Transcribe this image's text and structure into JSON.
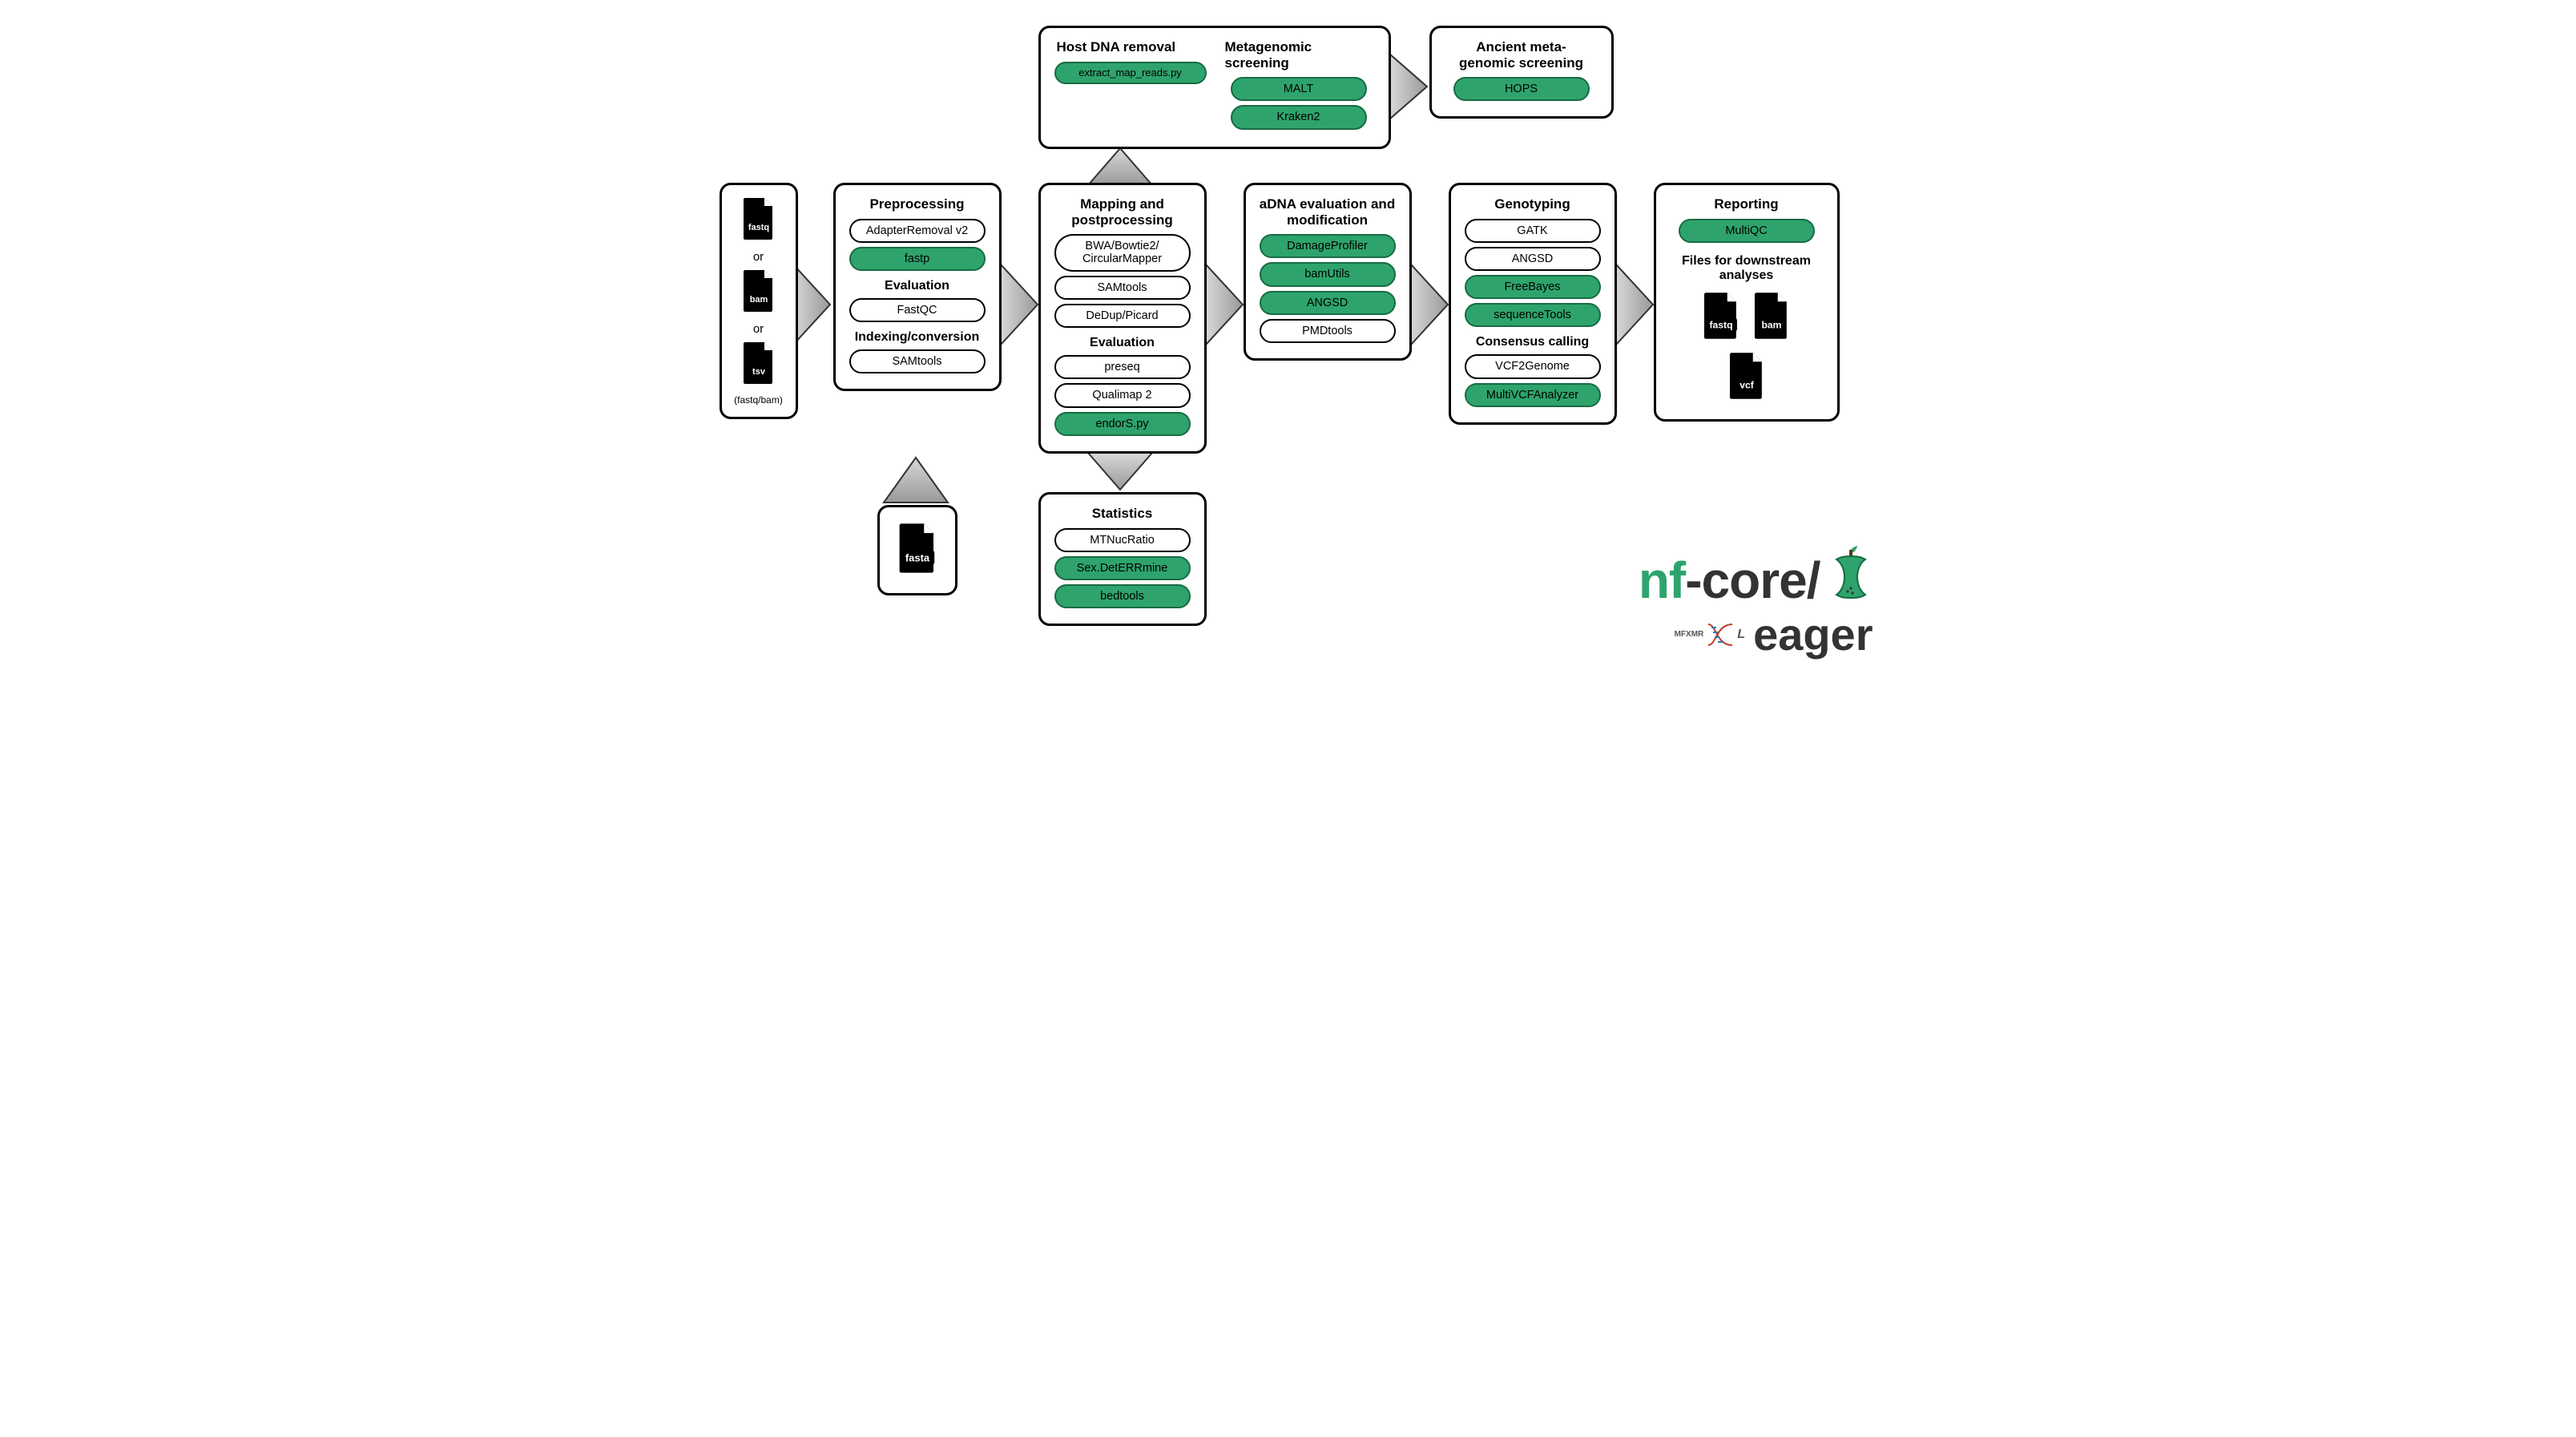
{
  "diagram_type": "pipeline-flowchart",
  "pipeline_name": "nf-core/eager",
  "input_panel": {
    "formats": [
      "fastq",
      "bam",
      "tsv"
    ],
    "or_label": "or",
    "footnote": "(fastq/bam)"
  },
  "reference_panel": {
    "format": "fasta"
  },
  "stages": {
    "preprocessing": {
      "title": "Preprocessing",
      "tools": [
        {
          "name": "AdapterRemoval v2",
          "highlighted": false
        },
        {
          "name": "fastp",
          "highlighted": true
        }
      ],
      "section2_title": "Evaluation",
      "section2_tools": [
        {
          "name": "FastQC",
          "highlighted": false
        }
      ],
      "section3_title": "Indexing/conversion",
      "section3_tools": [
        {
          "name": "SAMtools",
          "highlighted": false
        }
      ]
    },
    "mapping": {
      "title": "Mapping and postprocessing",
      "tools": [
        {
          "name": "BWA/Bowtie2/\nCircularMapper",
          "highlighted": false
        },
        {
          "name": "SAMtools",
          "highlighted": false
        },
        {
          "name": "DeDup/Picard",
          "highlighted": false
        }
      ],
      "section2_title": "Evaluation",
      "section2_tools": [
        {
          "name": "preseq",
          "highlighted": false
        },
        {
          "name": "Qualimap 2",
          "highlighted": false
        },
        {
          "name": "endorS.py",
          "highlighted": true
        }
      ]
    },
    "statistics": {
      "title": "Statistics",
      "tools": [
        {
          "name": "MTNucRatio",
          "highlighted": false
        },
        {
          "name": "Sex.DetERRmine",
          "highlighted": true
        },
        {
          "name": "bedtools",
          "highlighted": true
        }
      ]
    },
    "host_metagenomic": {
      "title1": "Host DNA removal",
      "tools1": [
        {
          "name": "extract_map_reads.py",
          "highlighted": true
        }
      ],
      "title2": "Metagenomic screening",
      "tools2": [
        {
          "name": "MALT",
          "highlighted": true
        },
        {
          "name": "Kraken2",
          "highlighted": true
        }
      ]
    },
    "ancient_metagenomic": {
      "title": "Ancient meta-\ngenomic screening",
      "tools": [
        {
          "name": "HOPS",
          "highlighted": true
        }
      ]
    },
    "adna": {
      "title": "aDNA evaluation and modification",
      "tools": [
        {
          "name": "DamageProfiler",
          "highlighted": true
        },
        {
          "name": "bamUtils",
          "highlighted": true
        },
        {
          "name": "ANGSD",
          "highlighted": true
        },
        {
          "name": "PMDtools",
          "highlighted": false
        }
      ]
    },
    "genotyping": {
      "title": "Genotyping",
      "tools": [
        {
          "name": "GATK",
          "highlighted": false
        },
        {
          "name": "ANGSD",
          "highlighted": false
        },
        {
          "name": "FreeBayes",
          "highlighted": true
        },
        {
          "name": "sequenceTools",
          "highlighted": true
        }
      ],
      "section2_title": "Consensus calling",
      "section2_tools": [
        {
          "name": "VCF2Genome",
          "highlighted": false
        },
        {
          "name": "MultiVCFAnalyzer",
          "highlighted": true
        }
      ]
    },
    "reporting": {
      "title": "Reporting",
      "tools": [
        {
          "name": "MultiQC",
          "highlighted": true
        }
      ],
      "section2_title": "Files for downstream analyses",
      "output_formats": [
        "fastq",
        "bam",
        "vcf"
      ]
    }
  },
  "logo": {
    "nf": "nf",
    "dash_core_slash": "-core/",
    "eager": "eager",
    "dna_text": "MFXMR",
    "dna_letter": "L"
  }
}
